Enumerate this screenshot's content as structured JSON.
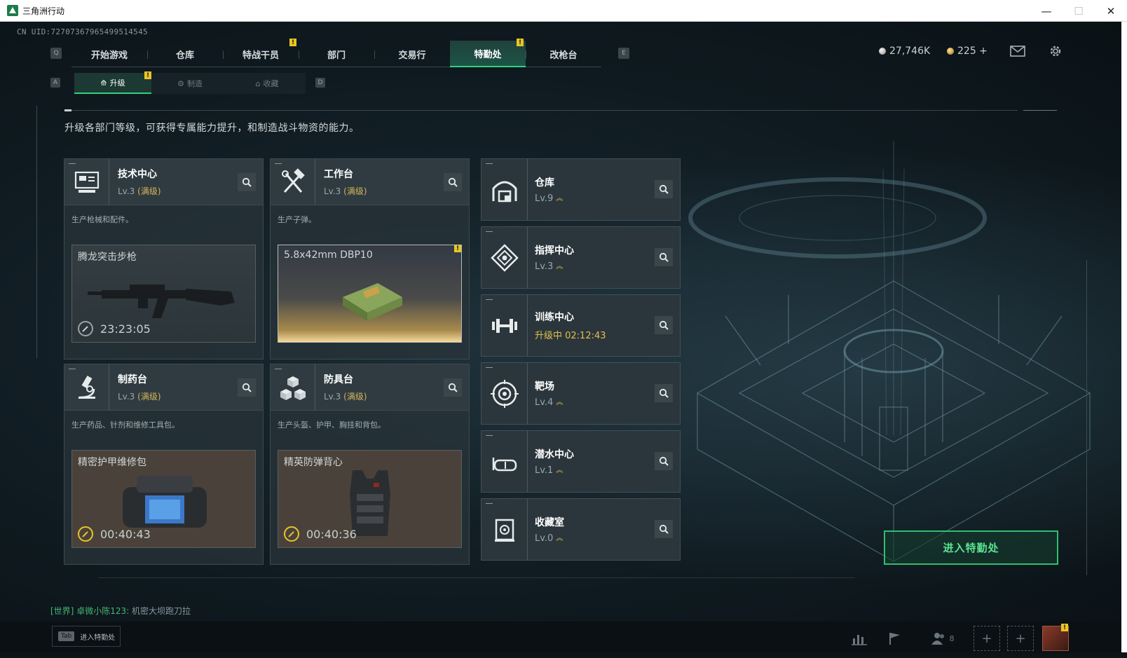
{
  "window": {
    "title": "三角洲行动",
    "minimize": "—",
    "maximize": "☐",
    "close": "✕"
  },
  "uid": "CN UID:72707367965499514545",
  "main_nav": {
    "left_key": "Q",
    "right_key": "E",
    "tabs": [
      {
        "label": "开始游戏"
      },
      {
        "label": "仓库"
      },
      {
        "label": "特战干员",
        "badge": "!"
      },
      {
        "label": "部门"
      },
      {
        "label": "交易行"
      },
      {
        "label": "特勤处",
        "active": true,
        "badge": "!"
      },
      {
        "label": "改枪台"
      }
    ]
  },
  "currency": {
    "silver": "27,746K",
    "gold": "225 +"
  },
  "sub_nav": {
    "left_key": "A",
    "right_key": "D",
    "tabs": [
      {
        "label": "升级",
        "active": true,
        "badge": "!"
      },
      {
        "label": "制造"
      },
      {
        "label": "收藏"
      }
    ]
  },
  "description": "升级各部门等级，可获得专属能力提升，和制造战斗物资的能力。",
  "stations": [
    {
      "name": "技术中心",
      "level": "Lv.3",
      "max": "(满级)",
      "desc": "生产枪械和配件。",
      "item": "腾龙突击步枪",
      "timer": "23:23:05",
      "icon": "computer-icon"
    },
    {
      "name": "工作台",
      "level": "Lv.3",
      "max": "(满级)",
      "desc": "生产子弹。",
      "item": "5.8x42mm DBP10",
      "timer": "",
      "icon": "hammer-wrench-icon",
      "badge": "!"
    },
    {
      "name": "制药台",
      "level": "Lv.3",
      "max": "(满级)",
      "desc": "生产药品、针剂和维修工具包。",
      "item": "精密护甲维修包",
      "timer": "00:40:43",
      "icon": "microscope-icon"
    },
    {
      "name": "防具台",
      "level": "Lv.3",
      "max": "(满级)",
      "desc": "生产头盔、护甲、胸挂和背包。",
      "item": "精英防弹背心",
      "timer": "00:40:36",
      "icon": "cubes-icon"
    }
  ],
  "facilities": [
    {
      "name": "仓库",
      "level": "Lv.9",
      "icon": "warehouse-icon"
    },
    {
      "name": "指挥中心",
      "level": "Lv.3",
      "icon": "command-icon"
    },
    {
      "name": "训练中心",
      "level": "升级中 02:12:43",
      "upgrading": true,
      "icon": "dumbbell-icon"
    },
    {
      "name": "靶场",
      "level": "Lv.4",
      "icon": "target-icon"
    },
    {
      "name": "潜水中心",
      "level": "Lv.1",
      "icon": "goggles-icon"
    },
    {
      "name": "收藏室",
      "level": "Lv.0",
      "icon": "vault-icon"
    }
  ],
  "enter_button": "进入特勤处",
  "chat": {
    "channel": "[世界]",
    "user": "卓微小陈123:",
    "message": "机密大坝跑刀拉"
  },
  "bottom": {
    "tab_key": "Tab",
    "tab_label": "进入特勤处",
    "friends_count": "8"
  },
  "colors": {
    "accent": "#33d17a",
    "gold": "#e8c52a",
    "panel": "#2f3b41"
  }
}
